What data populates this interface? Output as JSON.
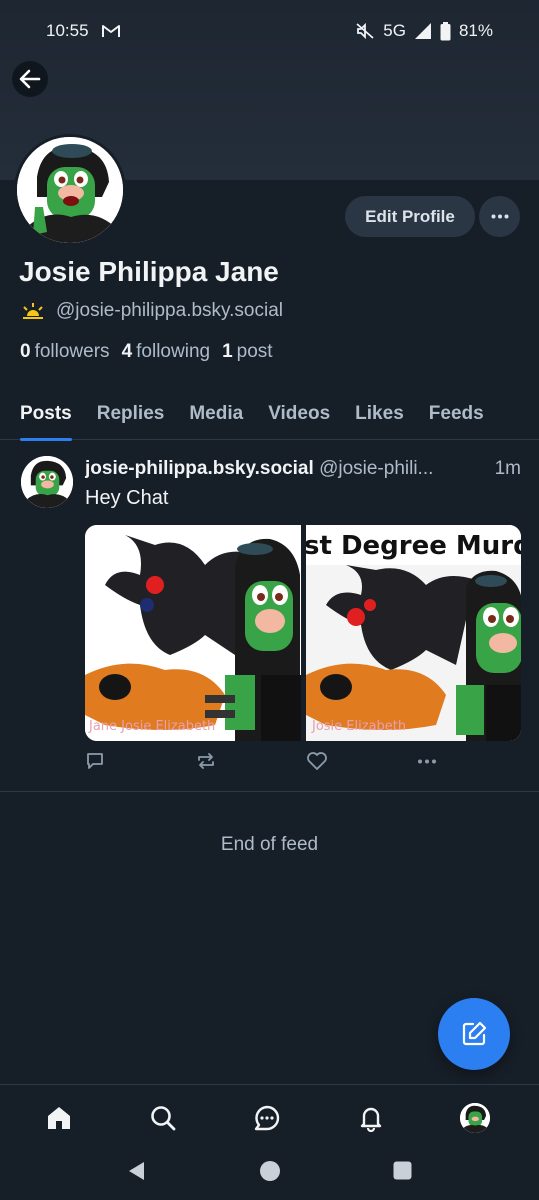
{
  "status_bar": {
    "time": "10:55",
    "network": "5G",
    "battery": "81%",
    "icons": [
      "gmail-icon",
      "mute-icon",
      "signal-icon",
      "battery-icon"
    ]
  },
  "profile": {
    "name": "Josie Philippa Jane",
    "handle": "@josie-philippa.bsky.social",
    "followers_count": "0",
    "followers_label": "followers",
    "following_count": "4",
    "following_label": "following",
    "posts_count": "1",
    "posts_label": "post",
    "edit_label": "Edit Profile"
  },
  "tabs": [
    {
      "label": "Posts",
      "active": true
    },
    {
      "label": "Replies"
    },
    {
      "label": "Media"
    },
    {
      "label": "Videos"
    },
    {
      "label": "Likes"
    },
    {
      "label": "Feeds"
    }
  ],
  "post": {
    "author": "josie-philippa.bsky.social",
    "handle": "@josie-phili...",
    "time": "1m",
    "text": "Hey Chat",
    "image1_watermark": "Jane Josie Elizabeth",
    "image2_title": "st Degree Murd",
    "image2_watermark": "Josie Elizabeth"
  },
  "feed_end": "End of feed",
  "colors": {
    "background": "#161e27",
    "accent": "#2b7ff0",
    "muted_text": "#aebbc9",
    "button_bg": "#2a3644"
  }
}
